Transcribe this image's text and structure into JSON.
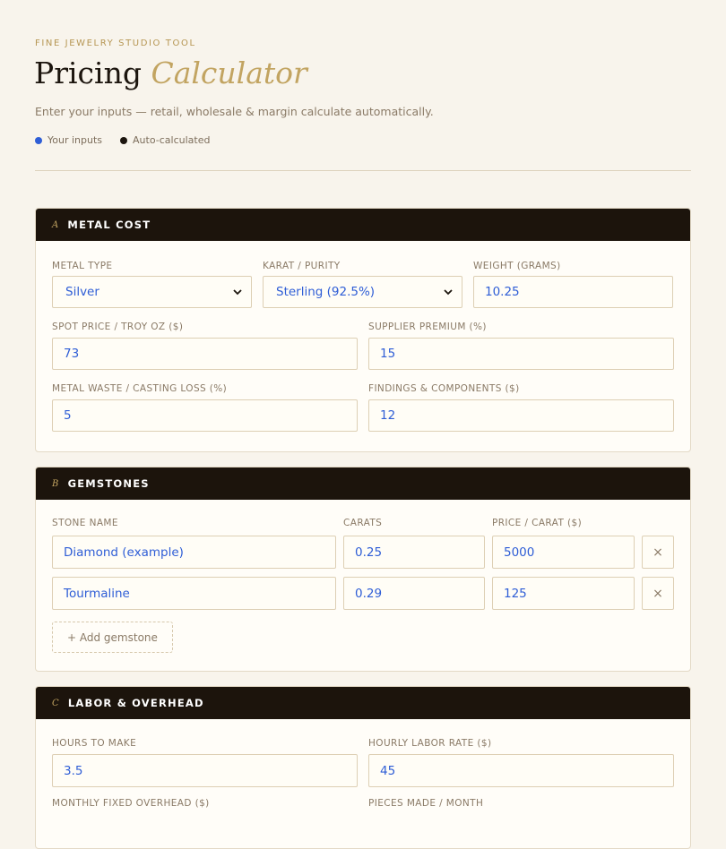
{
  "header": {
    "eyebrow": "FINE JEWELRY STUDIO TOOL",
    "title_main": "Pricing",
    "title_accent": "Calculator",
    "subtitle": "Enter your inputs — retail, wholesale & margin calculate automatically.",
    "legend": [
      {
        "label": "Your inputs",
        "color": "#2f5ed6"
      },
      {
        "label": "Auto-calculated",
        "color": "#1c150e"
      }
    ]
  },
  "metal": {
    "letter": "A",
    "title": "METAL COST",
    "metal_type_label": "METAL TYPE",
    "metal_type_value": "Silver",
    "karat_label": "KARAT / PURITY",
    "karat_value": "Sterling (92.5%)",
    "weight_label": "WEIGHT (GRAMS)",
    "weight_value": "10.25",
    "spot_label": "SPOT PRICE / TROY OZ ($)",
    "spot_value": "73",
    "premium_label": "SUPPLIER PREMIUM (%)",
    "premium_value": "15",
    "waste_label": "METAL WASTE / CASTING LOSS (%)",
    "waste_value": "5",
    "findings_label": "FINDINGS & COMPONENTS ($)",
    "findings_value": "12"
  },
  "gems": {
    "letter": "B",
    "title": "GEMSTONES",
    "col_name": "STONE NAME",
    "col_carats": "CARATS",
    "col_price": "PRICE / CARAT ($)",
    "rows": [
      {
        "name": "Diamond (example)",
        "carats": "0.25",
        "price": "5000",
        "remove": "×"
      },
      {
        "name": "Tourmaline",
        "carats": "0.29",
        "price": "125",
        "remove": "×"
      }
    ],
    "add_label": "+ Add gemstone"
  },
  "labor": {
    "letter": "C",
    "title": "LABOR & OVERHEAD",
    "hours_label": "HOURS TO MAKE",
    "hours_value": "3.5",
    "rate_label": "HOURLY LABOR RATE ($)",
    "rate_value": "45",
    "overhead_label": "MONTHLY FIXED OVERHEAD ($)",
    "pieces_label": "PIECES MADE / MONTH"
  }
}
